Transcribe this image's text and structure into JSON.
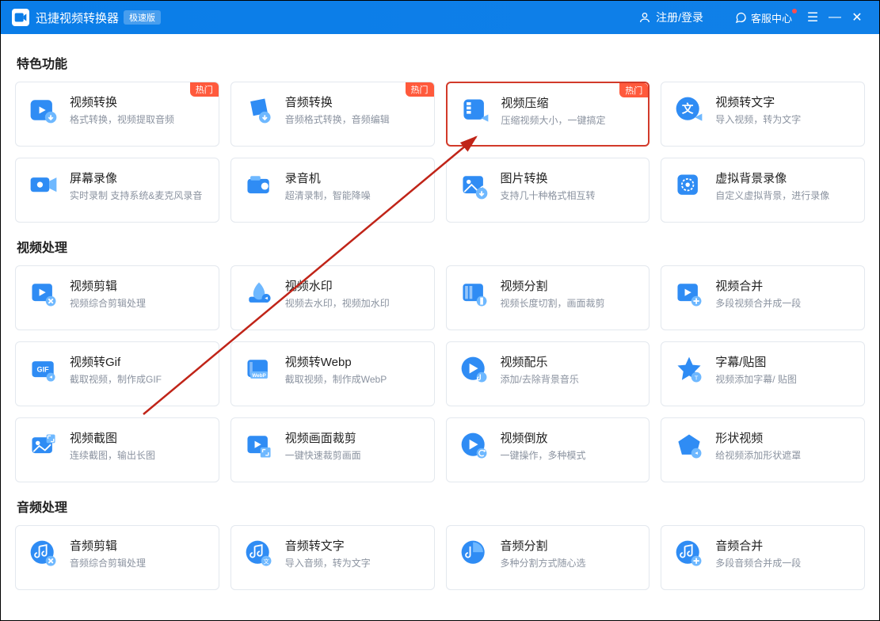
{
  "titlebar": {
    "app_title": "迅捷视频转换器",
    "edition": "极速版",
    "login": "注册/登录",
    "help": "客服中心"
  },
  "sections": {
    "featured": "特色功能",
    "video": "视频处理",
    "audio": "音频处理"
  },
  "badge_hot": "热门",
  "cards": {
    "video_convert": {
      "title": "视频转换",
      "desc": "格式转换，视频提取音频"
    },
    "audio_convert": {
      "title": "音频转换",
      "desc": "音频格式转换，音频编辑"
    },
    "video_compress": {
      "title": "视频压缩",
      "desc": "压缩视频大小，一键搞定"
    },
    "video_to_text": {
      "title": "视频转文字",
      "desc": "导入视频，转为文字"
    },
    "screen_record": {
      "title": "屏幕录像",
      "desc": "实时录制 支持系统&麦克风录音"
    },
    "recorder": {
      "title": "录音机",
      "desc": "超清录制，智能降噪"
    },
    "image_convert": {
      "title": "图片转换",
      "desc": "支持几十种格式相互转"
    },
    "virtual_bg": {
      "title": "虚拟背景录像",
      "desc": "自定义虚拟背景，进行录像"
    },
    "video_edit": {
      "title": "视频剪辑",
      "desc": "视频综合剪辑处理"
    },
    "watermark": {
      "title": "视频水印",
      "desc": "视频去水印，视频加水印"
    },
    "video_split": {
      "title": "视频分割",
      "desc": "视频长度切割，画面裁剪"
    },
    "video_merge": {
      "title": "视频合并",
      "desc": "多段视频合并成一段"
    },
    "video_gif": {
      "title": "视频转Gif",
      "desc": "截取视频，制作成GIF"
    },
    "video_webp": {
      "title": "视频转Webp",
      "desc": "截取视频，制作成WebP"
    },
    "video_music": {
      "title": "视频配乐",
      "desc": "添加/去除背景音乐"
    },
    "subtitle": {
      "title": "字幕/贴图",
      "desc": "视频添加字幕/ 贴图"
    },
    "screenshot": {
      "title": "视频截图",
      "desc": "连续截图，输出长图"
    },
    "crop": {
      "title": "视频画面裁剪",
      "desc": "一键快速裁剪画面"
    },
    "reverse": {
      "title": "视频倒放",
      "desc": "一键操作，多种模式"
    },
    "shape_video": {
      "title": "形状视频",
      "desc": "给视频添加形状遮罩"
    },
    "audio_edit": {
      "title": "音频剪辑",
      "desc": "音频综合剪辑处理"
    },
    "audio_to_text": {
      "title": "音频转文字",
      "desc": "导入音频，转为文字"
    },
    "audio_split": {
      "title": "音频分割",
      "desc": "多种分割方式随心选"
    },
    "audio_merge": {
      "title": "音频合并",
      "desc": "多段音频合并成一段"
    }
  }
}
